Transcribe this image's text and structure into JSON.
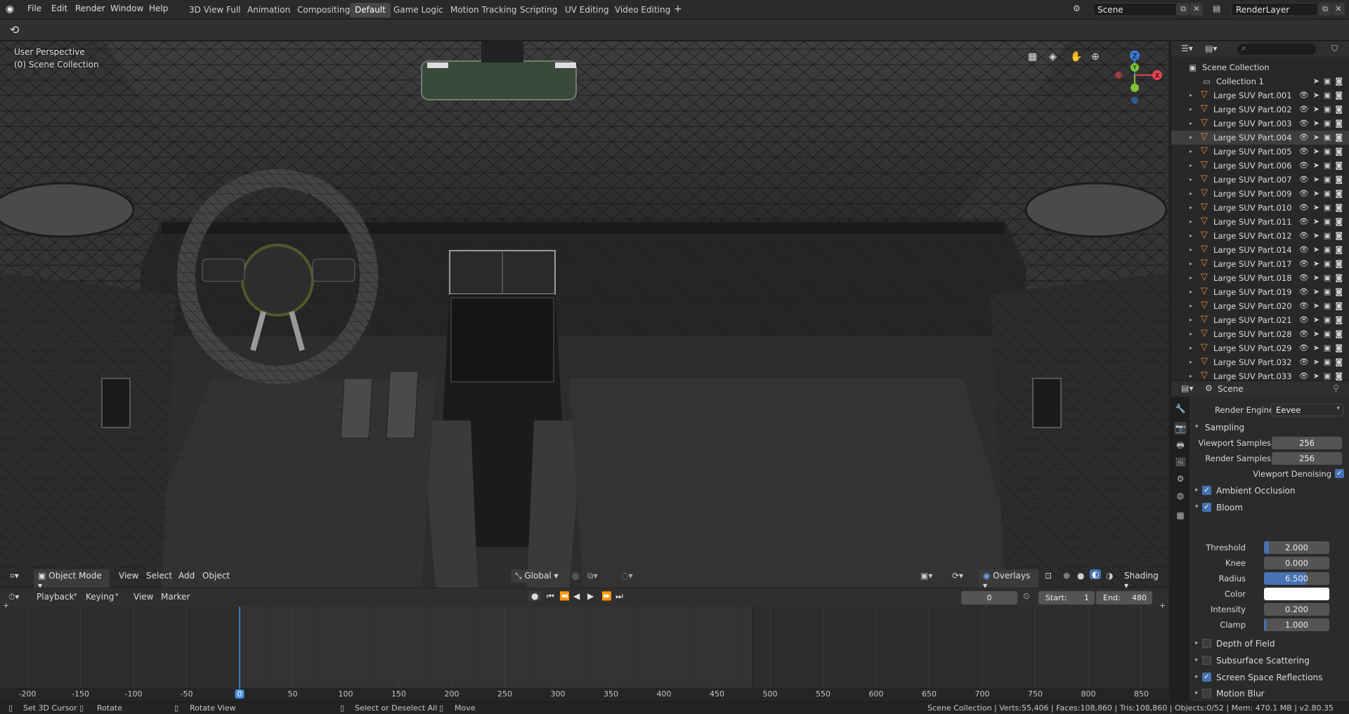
{
  "menu": [
    "File",
    "Edit",
    "Render",
    "Window",
    "Help"
  ],
  "workspaces": [
    "3D View Full",
    "Animation",
    "Compositing",
    "Default",
    "Game Logic",
    "Motion Tracking",
    "Scripting",
    "UV Editing",
    "Video Editing"
  ],
  "active_workspace": "Default",
  "add_tab_label": "+",
  "scene_field": "Scene",
  "view_layer_field": "RenderLayer",
  "viewport": {
    "perspective": "User Perspective",
    "collection": "(0) Scene Collection",
    "mode": "Object Mode",
    "menus": [
      "View",
      "Select",
      "Add",
      "Object"
    ],
    "transform_orientation": "Global",
    "overlays_label": "Overlays",
    "shading_label": "Shading",
    "gizmo_labels": {
      "z": "Z",
      "y": "Y",
      "x": "X"
    }
  },
  "timeline": {
    "menus": [
      "Playback",
      "Keying",
      "View",
      "Marker"
    ],
    "current_frame": "0",
    "start_label": "Start:",
    "start": "1",
    "end_label": "End:",
    "end": "480",
    "ruler": [
      "-200",
      "-150",
      "-100",
      "-50",
      "0",
      "50",
      "100",
      "150",
      "200",
      "250",
      "300",
      "350",
      "400",
      "450",
      "500",
      "550",
      "600",
      "650",
      "700",
      "750",
      "800",
      "850"
    ],
    "playhead_label": "0"
  },
  "outliner": {
    "root": "Scene Collection",
    "collection": "Collection 1",
    "items": [
      "Large SUV Part.001",
      "Large SUV Part.002",
      "Large SUV Part.003",
      "Large SUV Part.004",
      "Large SUV Part.005",
      "Large SUV Part.006",
      "Large SUV Part.007",
      "Large SUV Part.009",
      "Large SUV Part.010",
      "Large SUV Part.011",
      "Large SUV Part.012",
      "Large SUV Part.014",
      "Large SUV Part.017",
      "Large SUV Part.018",
      "Large SUV Part.019",
      "Large SUV Part.020",
      "Large SUV Part.021",
      "Large SUV Part.028",
      "Large SUV Part.029",
      "Large SUV Part.032",
      "Large SUV Part.033"
    ],
    "selected_index": 3
  },
  "properties": {
    "context": "Scene",
    "render_engine_label": "Render Engine",
    "render_engine": "Eevee",
    "sampling_label": "Sampling",
    "viewport_samples_label": "Viewport Samples",
    "viewport_samples": "256",
    "render_samples_label": "Render Samples",
    "render_samples": "256",
    "viewport_denoising_label": "Viewport Denoising",
    "ambient_occlusion_label": "Ambient Occlusion",
    "bloom_label": "Bloom",
    "bloom": {
      "threshold_label": "Threshold",
      "threshold": "2.000",
      "threshold_fill": 0.08,
      "knee_label": "Knee",
      "knee": "0.000",
      "radius_label": "Radius",
      "radius": "6.500",
      "radius_fill": 0.65,
      "color_label": "Color",
      "color": "#ffffff",
      "intensity_label": "Intensity",
      "intensity": "0.200",
      "clamp_label": "Clamp",
      "clamp": "1.000",
      "clamp_fill": 0.03
    },
    "depth_of_field_label": "Depth of Field",
    "subsurface_label": "Subsurface Scattering",
    "ssr_label": "Screen Space Reflections",
    "motion_blur_label": "Motion Blur"
  },
  "status": {
    "hint1": "Set 3D Cursor",
    "hint2": "Rotate",
    "hint3": "Rotate View",
    "hint4": "Select or Deselect All",
    "hint5": "Move",
    "stats": "Scene Collection | Verts:55,406 | Faces:108,860 | Tris:108,860 | Objects:0/52 | Mem: 470.1 MB | v2.80.35"
  },
  "colors": {
    "accent": "#4772b3",
    "object_icon": "#e68a3a",
    "gizmo_x": "#e4434f",
    "gizmo_y": "#7ec434",
    "gizmo_z": "#3d7bd8"
  }
}
